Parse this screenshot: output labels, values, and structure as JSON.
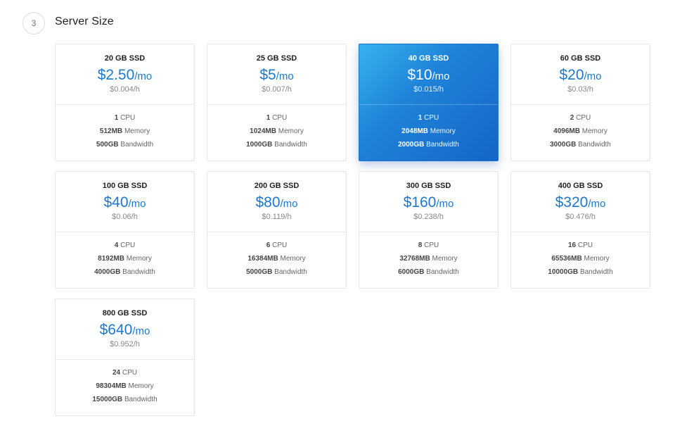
{
  "section": {
    "step_number": "3",
    "title": "Server Size"
  },
  "colors": {
    "accent": "#1b78d0",
    "selected_start": "#39b3f0",
    "selected_end": "#1565c6"
  },
  "selected_index": 2,
  "plans": [
    {
      "storage": "20 GB SSD",
      "price": "$2.50",
      "per": "/mo",
      "hourly": "$0.004/h",
      "cpu": "1",
      "cpu_label": "CPU",
      "memory": "512MB",
      "memory_label": "Memory",
      "bandwidth": "500GB",
      "bandwidth_label": "Bandwidth"
    },
    {
      "storage": "25 GB SSD",
      "price": "$5",
      "per": "/mo",
      "hourly": "$0.007/h",
      "cpu": "1",
      "cpu_label": "CPU",
      "memory": "1024MB",
      "memory_label": "Memory",
      "bandwidth": "1000GB",
      "bandwidth_label": "Bandwidth"
    },
    {
      "storage": "40 GB SSD",
      "price": "$10",
      "per": "/mo",
      "hourly": "$0.015/h",
      "cpu": "1",
      "cpu_label": "CPU",
      "memory": "2048MB",
      "memory_label": "Memory",
      "bandwidth": "2000GB",
      "bandwidth_label": "Bandwidth"
    },
    {
      "storage": "60 GB SSD",
      "price": "$20",
      "per": "/mo",
      "hourly": "$0.03/h",
      "cpu": "2",
      "cpu_label": "CPU",
      "memory": "4096MB",
      "memory_label": "Memory",
      "bandwidth": "3000GB",
      "bandwidth_label": "Bandwidth"
    },
    {
      "storage": "100 GB SSD",
      "price": "$40",
      "per": "/mo",
      "hourly": "$0.06/h",
      "cpu": "4",
      "cpu_label": "CPU",
      "memory": "8192MB",
      "memory_label": "Memory",
      "bandwidth": "4000GB",
      "bandwidth_label": "Bandwidth"
    },
    {
      "storage": "200 GB SSD",
      "price": "$80",
      "per": "/mo",
      "hourly": "$0.119/h",
      "cpu": "6",
      "cpu_label": "CPU",
      "memory": "16384MB",
      "memory_label": "Memory",
      "bandwidth": "5000GB",
      "bandwidth_label": "Bandwidth"
    },
    {
      "storage": "300 GB SSD",
      "price": "$160",
      "per": "/mo",
      "hourly": "$0.238/h",
      "cpu": "8",
      "cpu_label": "CPU",
      "memory": "32768MB",
      "memory_label": "Memory",
      "bandwidth": "6000GB",
      "bandwidth_label": "Bandwidth"
    },
    {
      "storage": "400 GB SSD",
      "price": "$320",
      "per": "/mo",
      "hourly": "$0.476/h",
      "cpu": "16",
      "cpu_label": "CPU",
      "memory": "65536MB",
      "memory_label": "Memory",
      "bandwidth": "10000GB",
      "bandwidth_label": "Bandwidth"
    },
    {
      "storage": "800 GB SSD",
      "price": "$640",
      "per": "/mo",
      "hourly": "$0.952/h",
      "cpu": "24",
      "cpu_label": "CPU",
      "memory": "98304MB",
      "memory_label": "Memory",
      "bandwidth": "15000GB",
      "bandwidth_label": "Bandwidth"
    }
  ]
}
